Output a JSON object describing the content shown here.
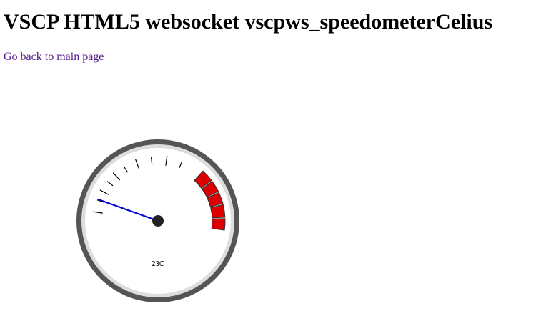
{
  "page": {
    "title": "VSCP HTML5 websocket vscpws_speedometerCelius",
    "back_link": "Go back to main page"
  },
  "gauge": {
    "value": 23,
    "min": 0,
    "max": 100,
    "readout": "23C",
    "colors": {
      "rim_outer": "#555555",
      "rim_inner": "#dddddd",
      "face": "#ffffff",
      "ticks": "#000000",
      "redzone": "#dd0000",
      "needle": "#0000cc",
      "hub": "#222222"
    }
  }
}
